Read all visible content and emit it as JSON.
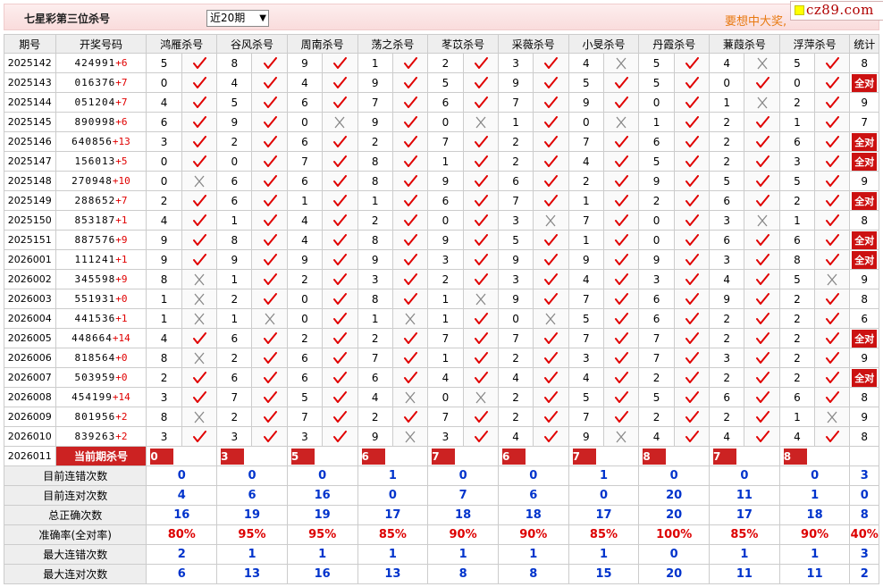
{
  "header": {
    "title": "七星彩第三位杀号",
    "period_select_value": "近20期",
    "promo_text": "要想中大奖,",
    "logo_text": "cz89.com"
  },
  "table": {
    "col_issue": "期号",
    "col_draw": "开奖号码",
    "col_count": "统计",
    "experts": [
      "鸿雁杀号",
      "谷风杀号",
      "周南杀号",
      "荡之杀号",
      "苳苡杀号",
      "采薇杀号",
      "小旻杀号",
      "丹霞杀号",
      "蒹葭杀号",
      "浮萍杀号"
    ],
    "rows": [
      {
        "issue": "2025142",
        "draw": "424991",
        "plus": "+6",
        "kills": [
          5,
          8,
          9,
          1,
          2,
          3,
          4,
          5,
          4,
          5
        ],
        "ok": [
          1,
          1,
          1,
          1,
          1,
          1,
          0,
          1,
          0,
          1
        ],
        "count": "8"
      },
      {
        "issue": "2025143",
        "draw": "016376",
        "plus": "+7",
        "kills": [
          0,
          4,
          4,
          9,
          5,
          9,
          5,
          5,
          0,
          0
        ],
        "ok": [
          1,
          1,
          1,
          1,
          1,
          1,
          1,
          1,
          1,
          1
        ],
        "count": "全对"
      },
      {
        "issue": "2025144",
        "draw": "051204",
        "plus": "+7",
        "kills": [
          4,
          5,
          6,
          7,
          6,
          7,
          9,
          0,
          1,
          2
        ],
        "ok": [
          1,
          1,
          1,
          1,
          1,
          1,
          1,
          1,
          0,
          1
        ],
        "count": "9"
      },
      {
        "issue": "2025145",
        "draw": "890998",
        "plus": "+6",
        "kills": [
          6,
          9,
          0,
          9,
          0,
          1,
          0,
          1,
          2,
          1
        ],
        "ok": [
          1,
          1,
          0,
          1,
          0,
          1,
          0,
          1,
          1,
          1
        ],
        "count": "7"
      },
      {
        "issue": "2025146",
        "draw": "640856",
        "plus": "+13",
        "kills": [
          3,
          2,
          6,
          2,
          7,
          2,
          7,
          6,
          2,
          6
        ],
        "ok": [
          1,
          1,
          1,
          1,
          1,
          1,
          1,
          1,
          1,
          1
        ],
        "count": "全对"
      },
      {
        "issue": "2025147",
        "draw": "156013",
        "plus": "+5",
        "kills": [
          0,
          0,
          7,
          8,
          1,
          2,
          4,
          5,
          2,
          3
        ],
        "ok": [
          1,
          1,
          1,
          1,
          1,
          1,
          1,
          1,
          1,
          1
        ],
        "count": "全对"
      },
      {
        "issue": "2025148",
        "draw": "270948",
        "plus": "+10",
        "kills": [
          0,
          6,
          6,
          8,
          9,
          6,
          2,
          9,
          5,
          5
        ],
        "ok": [
          0,
          1,
          1,
          1,
          1,
          1,
          1,
          1,
          1,
          1
        ],
        "count": "9"
      },
      {
        "issue": "2025149",
        "draw": "288652",
        "plus": "+7",
        "kills": [
          2,
          6,
          1,
          1,
          6,
          7,
          1,
          2,
          6,
          2
        ],
        "ok": [
          1,
          1,
          1,
          1,
          1,
          1,
          1,
          1,
          1,
          1
        ],
        "count": "全对"
      },
      {
        "issue": "2025150",
        "draw": "853187",
        "plus": "+1",
        "kills": [
          4,
          1,
          4,
          2,
          0,
          3,
          7,
          0,
          3,
          1
        ],
        "ok": [
          1,
          1,
          1,
          1,
          1,
          0,
          1,
          1,
          0,
          1
        ],
        "count": "8"
      },
      {
        "issue": "2025151",
        "draw": "887576",
        "plus": "+9",
        "kills": [
          9,
          8,
          4,
          8,
          9,
          5,
          1,
          0,
          6,
          6
        ],
        "ok": [
          1,
          1,
          1,
          1,
          1,
          1,
          1,
          1,
          1,
          1
        ],
        "count": "全对"
      },
      {
        "issue": "2026001",
        "draw": "111241",
        "plus": "+1",
        "kills": [
          9,
          9,
          9,
          9,
          3,
          9,
          9,
          9,
          3,
          8
        ],
        "ok": [
          1,
          1,
          1,
          1,
          1,
          1,
          1,
          1,
          1,
          1
        ],
        "count": "全对"
      },
      {
        "issue": "2026002",
        "draw": "345598",
        "plus": "+9",
        "kills": [
          8,
          1,
          2,
          3,
          2,
          3,
          4,
          3,
          4,
          5
        ],
        "ok": [
          0,
          1,
          1,
          1,
          1,
          1,
          1,
          1,
          1,
          0
        ],
        "count": "9"
      },
      {
        "issue": "2026003",
        "draw": "551931",
        "plus": "+0",
        "kills": [
          1,
          2,
          0,
          8,
          1,
          9,
          7,
          6,
          9,
          2
        ],
        "ok": [
          0,
          1,
          1,
          1,
          0,
          1,
          1,
          1,
          1,
          1
        ],
        "count": "8"
      },
      {
        "issue": "2026004",
        "draw": "441536",
        "plus": "+1",
        "kills": [
          1,
          1,
          0,
          1,
          1,
          0,
          5,
          6,
          2,
          2
        ],
        "ok": [
          0,
          0,
          1,
          0,
          1,
          0,
          1,
          1,
          1,
          1
        ],
        "count": "6"
      },
      {
        "issue": "2026005",
        "draw": "448664",
        "plus": "+14",
        "kills": [
          4,
          6,
          2,
          2,
          7,
          7,
          7,
          7,
          2,
          2
        ],
        "ok": [
          1,
          1,
          1,
          1,
          1,
          1,
          1,
          1,
          1,
          1
        ],
        "count": "全对"
      },
      {
        "issue": "2026006",
        "draw": "818564",
        "plus": "+0",
        "kills": [
          8,
          2,
          6,
          7,
          1,
          2,
          3,
          7,
          3,
          2
        ],
        "ok": [
          0,
          1,
          1,
          1,
          1,
          1,
          1,
          1,
          1,
          1
        ],
        "count": "9"
      },
      {
        "issue": "2026007",
        "draw": "503959",
        "plus": "+0",
        "kills": [
          2,
          6,
          6,
          6,
          4,
          4,
          4,
          2,
          2,
          2
        ],
        "ok": [
          1,
          1,
          1,
          1,
          1,
          1,
          1,
          1,
          1,
          1
        ],
        "count": "全对"
      },
      {
        "issue": "2026008",
        "draw": "454199",
        "plus": "+14",
        "kills": [
          3,
          7,
          5,
          4,
          0,
          2,
          5,
          5,
          6,
          6
        ],
        "ok": [
          1,
          1,
          1,
          0,
          0,
          1,
          1,
          1,
          1,
          1
        ],
        "count": "8"
      },
      {
        "issue": "2026009",
        "draw": "801956",
        "plus": "+2",
        "kills": [
          8,
          2,
          7,
          2,
          7,
          2,
          7,
          2,
          2,
          1
        ],
        "ok": [
          0,
          1,
          1,
          1,
          1,
          1,
          1,
          1,
          1,
          0
        ],
        "count": "9"
      },
      {
        "issue": "2026010",
        "draw": "839263",
        "plus": "+2",
        "kills": [
          3,
          3,
          3,
          9,
          3,
          4,
          9,
          4,
          4,
          4
        ],
        "ok": [
          1,
          1,
          1,
          0,
          1,
          1,
          0,
          1,
          1,
          1
        ],
        "count": "8"
      }
    ],
    "current": {
      "issue": "2026011",
      "label": "当前期杀号",
      "kills": [
        "0",
        "3",
        "5",
        "6",
        "7",
        "6",
        "7",
        "8",
        "7",
        "8"
      ]
    },
    "summary": [
      {
        "label": "目前连错次数",
        "values": [
          "0",
          "0",
          "0",
          "1",
          "0",
          "0",
          "1",
          "0",
          "0",
          "0"
        ],
        "count": "3",
        "red": false
      },
      {
        "label": "目前连对次数",
        "values": [
          "4",
          "6",
          "16",
          "0",
          "7",
          "6",
          "0",
          "20",
          "11",
          "1"
        ],
        "count": "0",
        "red": false
      },
      {
        "label": "总正确次数",
        "values": [
          "16",
          "19",
          "19",
          "17",
          "18",
          "18",
          "17",
          "20",
          "17",
          "18"
        ],
        "count": "8",
        "red": false
      },
      {
        "label": "准确率(全对率)",
        "values": [
          "80%",
          "95%",
          "95%",
          "85%",
          "90%",
          "90%",
          "85%",
          "100%",
          "85%",
          "90%"
        ],
        "count": "40%",
        "red": true
      },
      {
        "label": "最大连错次数",
        "values": [
          "2",
          "1",
          "1",
          "1",
          "1",
          "1",
          "1",
          "0",
          "1",
          "1"
        ],
        "count": "3",
        "red": false
      },
      {
        "label": "最大连对次数",
        "values": [
          "6",
          "13",
          "16",
          "13",
          "8",
          "8",
          "15",
          "20",
          "11",
          "11"
        ],
        "count": "2",
        "red": false
      }
    ]
  },
  "colors": {
    "accent_red": "#cc2222",
    "check_red": "#e00000",
    "cross_gray": "#888888",
    "summary_blue": "#0033cc"
  }
}
